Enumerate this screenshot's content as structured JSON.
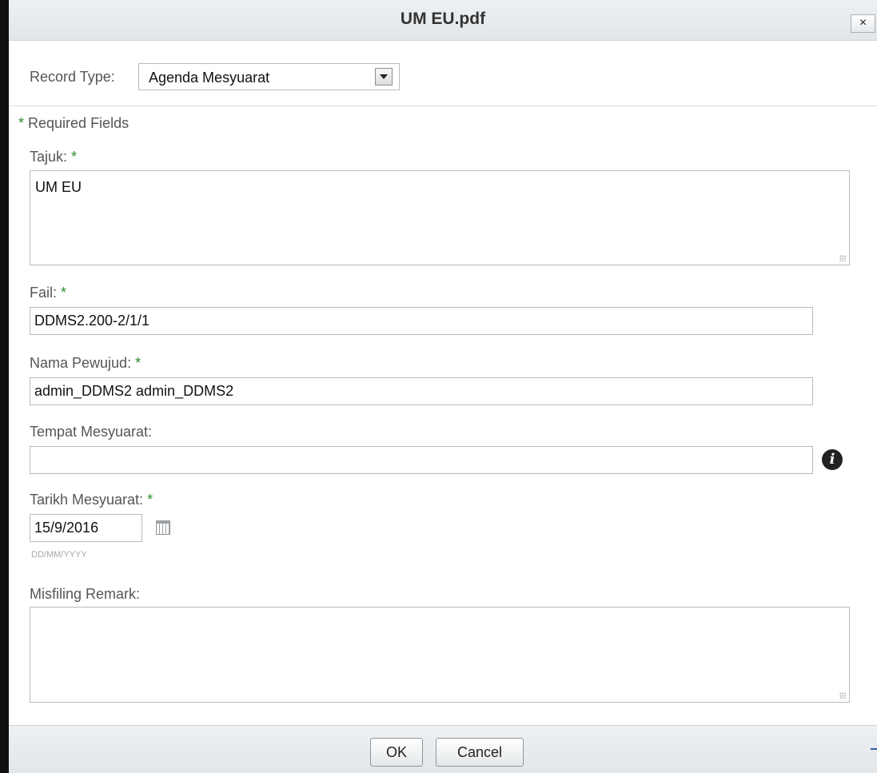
{
  "dialog": {
    "title": "UM EU.pdf",
    "close_label": "×"
  },
  "record_type": {
    "label": "Record Type:",
    "value": "Agenda Mesyuarat"
  },
  "required_note": {
    "star": "*",
    "text": " Required Fields"
  },
  "fields": {
    "tajuk": {
      "label": "Tajuk:",
      "value": "UM EU",
      "required": true
    },
    "fail": {
      "label": "Fail:",
      "value": "DDMS2.200-2/1/1",
      "required": true
    },
    "nama_pewujud": {
      "label": "Nama Pewujud:",
      "value": "admin_DDMS2 admin_DDMS2",
      "required": true
    },
    "tempat_mesyuarat": {
      "label": "Tempat Mesyuarat:",
      "value": "",
      "required": false
    },
    "tarikh_mesyuarat": {
      "label": "Tarikh Mesyuarat:",
      "value": "15/9/2016",
      "hint": "DD/MM/YYYY",
      "required": true
    },
    "misfiling_remark": {
      "label": "Misfiling Remark:",
      "value": "",
      "required": false
    }
  },
  "required_marker": "*",
  "info_glyph": "i",
  "buttons": {
    "ok": "OK",
    "cancel": "Cancel"
  },
  "colors": {
    "required_star": "#2e8b2e",
    "header_bg": "#e9ecef",
    "accent": "#2d5ea8"
  },
  "icons": {
    "close": "close-icon",
    "dropdown": "chevron-down-icon",
    "info": "info-icon",
    "calendar": "calendar-icon"
  }
}
